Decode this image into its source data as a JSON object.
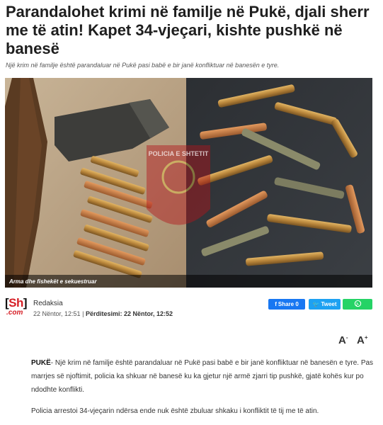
{
  "article": {
    "headline": "Parandalohet krimi në familje në Pukë, djali sherr me të atin! Kapet 34-vjeçari, kishte pushkë në banesë",
    "subheadline": "Një krim në familje është parandaluar në Pukë pasi babë e bir janë konfliktuar në banesën e tyre.",
    "photo_caption": "Arma dhe fishekët e sekuestruar",
    "photo_watermark": "POLICIA E SHTETIT",
    "author": "Redaksia",
    "published": "22 Nëntor, 12:51",
    "updated_label": "Përditesimi:",
    "updated": "22 Nëntor, 12:52",
    "separator": "|",
    "dateline": "PUKË",
    "paragraph_1_rest": "- Një krim në familje është parandaluar në Pukë pasi babë e bir janë konfliktuar në banesën e tyre. Pas marrjes së njoftimit, policia ka shkuar në banesë ku ka gjetur një armë zjarri tip pushkë, gjatë kohës kur po ndodhte konflikti.",
    "paragraph_2": "Policia arrestoi 34-vjeçarin ndërsa ende nuk është zbuluar shkaku i konfliktit të tij me të atin."
  },
  "logo": {
    "left_bracket": "[",
    "sh": "Sh",
    "right_bracket": "]",
    "com": ".com"
  },
  "share": {
    "facebook_label": "Share",
    "facebook_count": "0",
    "twitter_label": "Tweet",
    "whatsapp_label": ""
  },
  "font_controls": {
    "decrease": "A",
    "increase": "A",
    "decrease_sup": "-",
    "increase_sup": "+"
  },
  "colors": {
    "brand_red": "#d61f26",
    "facebook": "#1877f2",
    "twitter": "#1da1f2",
    "whatsapp": "#25d366"
  }
}
